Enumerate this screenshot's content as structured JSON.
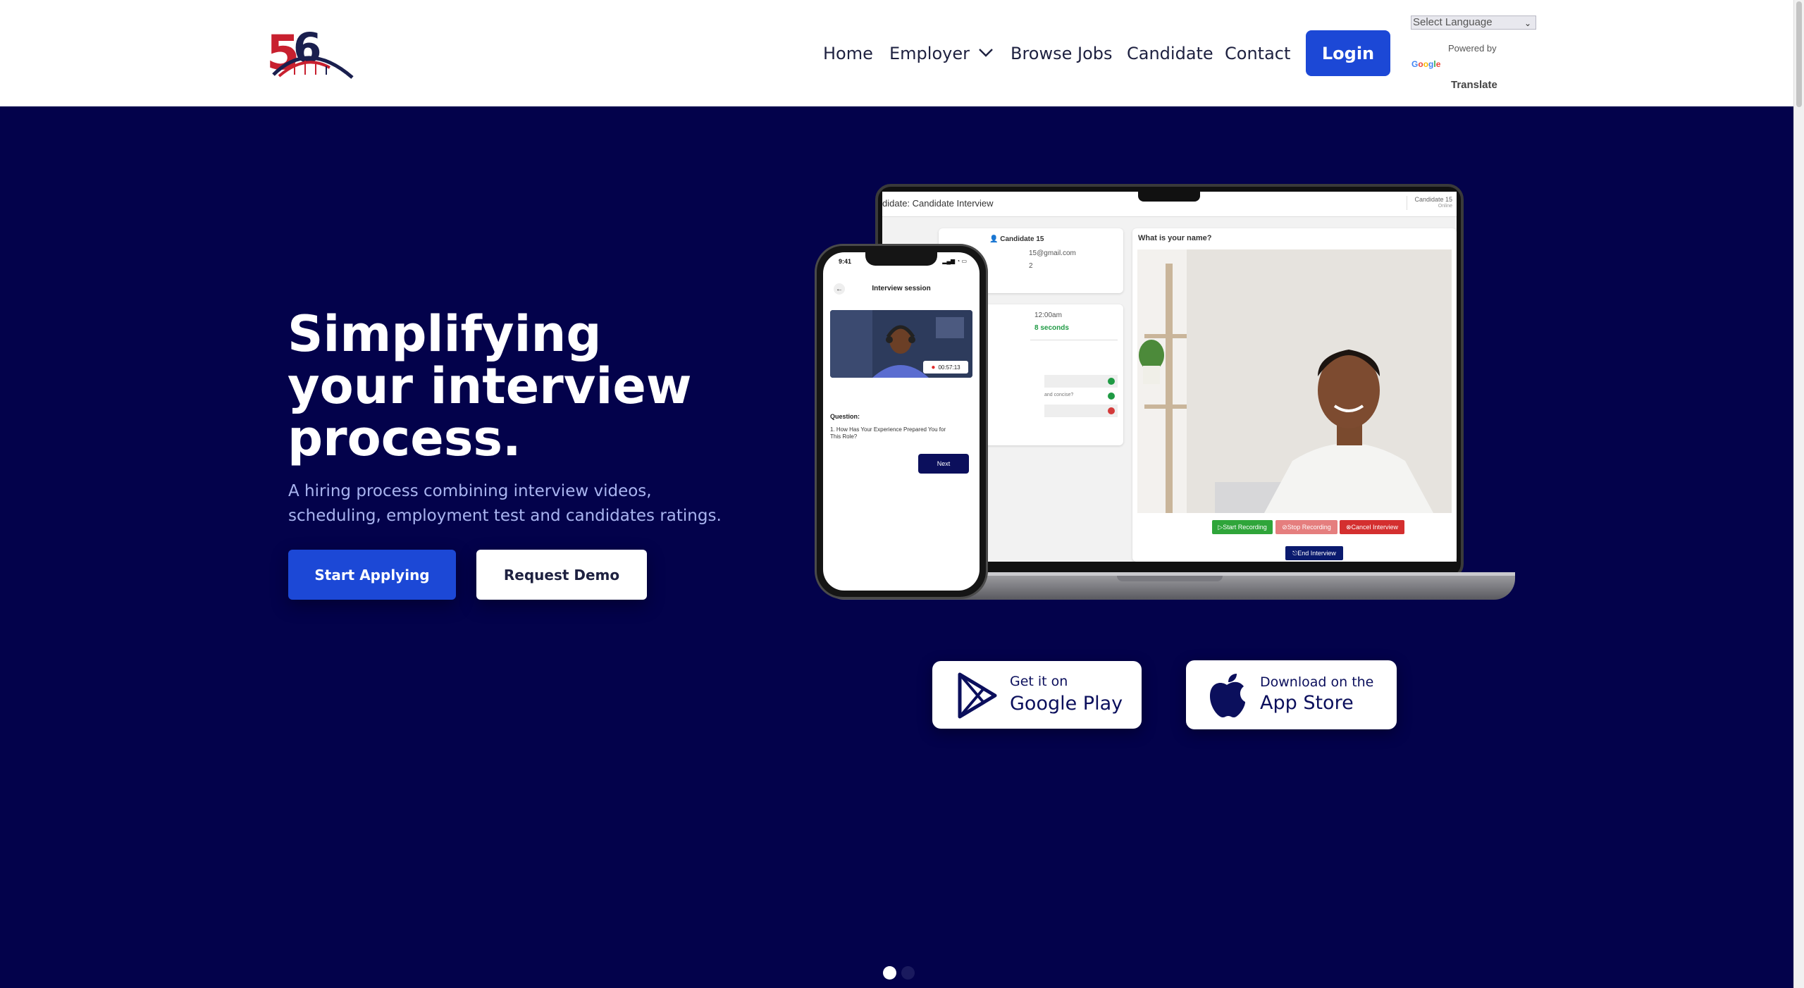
{
  "header": {
    "nav": [
      {
        "label": "Home"
      },
      {
        "label": "Employer"
      },
      {
        "label": "Browse Jobs"
      },
      {
        "label": "Candidate"
      },
      {
        "label": "Contact"
      }
    ],
    "login_label": "Login",
    "language_select": "Select Language",
    "powered_by": "Powered by",
    "google": "Google",
    "translate": "Translate"
  },
  "hero": {
    "title": "Simplifying your interview process.",
    "subtitle": "A hiring process combining interview videos, scheduling, employment test and candidates ratings.",
    "primary_button": "Start Applying",
    "secondary_button": "Request Demo"
  },
  "laptop_screen": {
    "title": "didate: Candidate Interview",
    "top_candidate": "Candidate 15",
    "top_status": "Online",
    "candidate_name": "Candidate 15",
    "email": "15@gmail.com",
    "phone_frag": "2",
    "time": "12:00am",
    "duration": "8 seconds",
    "concise_frag": "and concise?",
    "question": "What is your name?",
    "start_recording": "Start Recording",
    "stop_recording": "Stop Recording",
    "cancel_interview": "Cancel Interview",
    "end_interview": "End Interview"
  },
  "phone_screen": {
    "time": "9:41",
    "title": "Interview session",
    "timer": "00:57:13",
    "question_label": "Question:",
    "question_text": "1.  How Has Your Experience Prepared You for This Role?",
    "next_label": "Next"
  },
  "stores": {
    "google_small": "Get it on",
    "google_big": "Google Play",
    "apple_small": "Download on the",
    "apple_big": "App Store"
  },
  "colors": {
    "hero_bg": "#03024b",
    "brand_blue": "#1c48d6",
    "logo_red": "#c8202f",
    "logo_navy": "#1a1f4e"
  }
}
